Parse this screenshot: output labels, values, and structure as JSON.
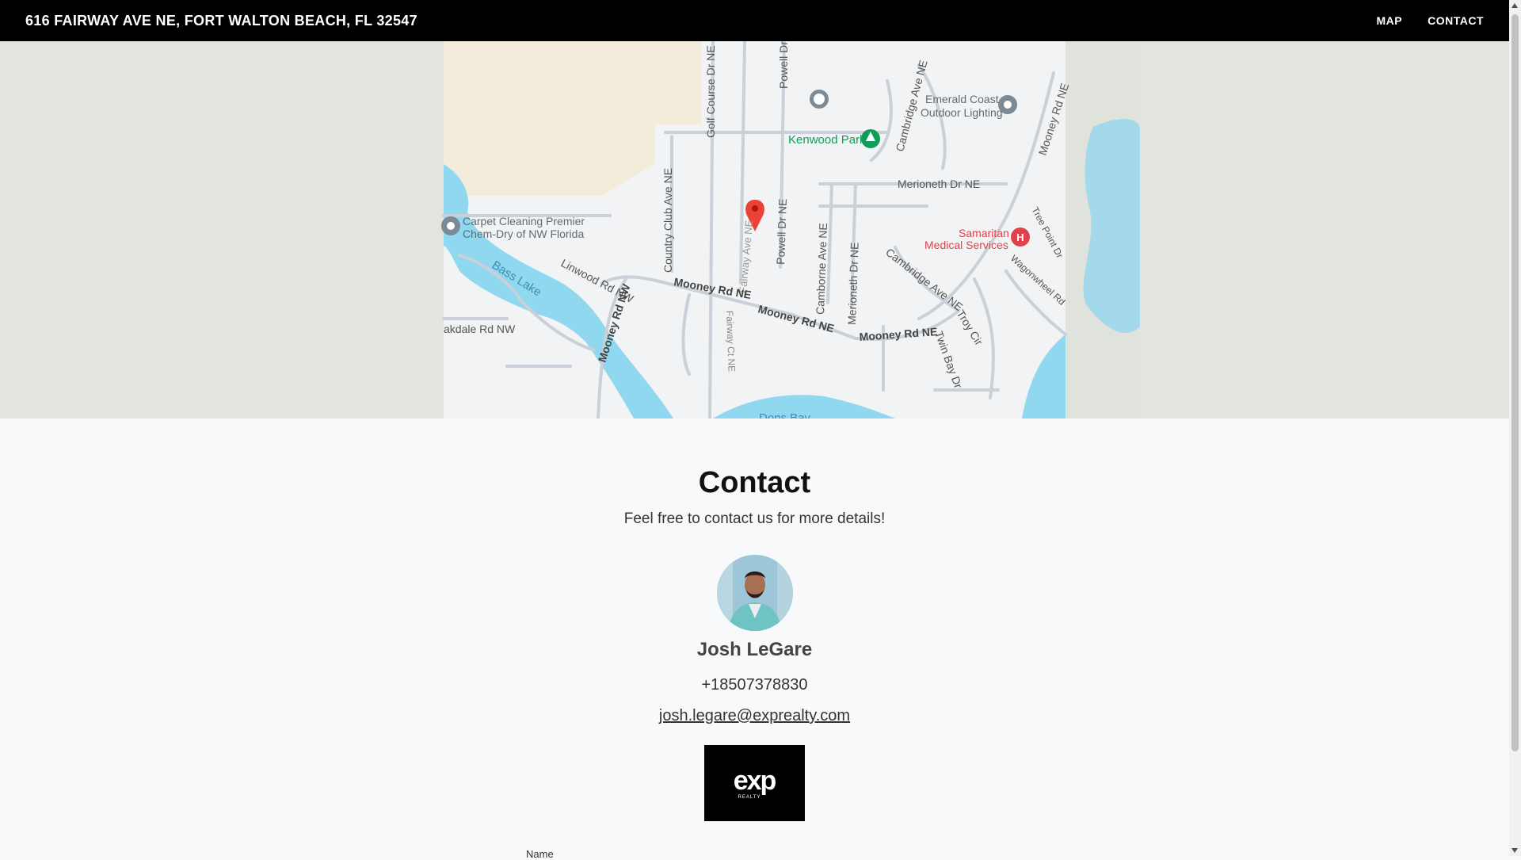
{
  "header": {
    "address": "616 FAIRWAY AVE NE, FORT WALTON BEACH, FL 32547",
    "nav": [
      {
        "label": "MAP"
      },
      {
        "label": "CONTACT"
      }
    ]
  },
  "map": {
    "labels": {
      "golf_course": "Golf Course Dr NE",
      "powell_top": "Powell Dr",
      "emerald_1": "Emerald Coast",
      "emerald_2": "Outdoor Lighting",
      "kenwood": "Kenwood Park",
      "cambridge_top": "Cambridge Ave NE",
      "mooney_right": "Mooney Rd NE",
      "merioneth_top": "Merioneth Dr NE",
      "carpet_1": "Carpet Cleaning Premier",
      "carpet_2": "Chem-Dry of NW Florida",
      "country_club": "Country Club Ave NE",
      "fairway": "Fairway Ave NE",
      "powell_mid": "Powell Dr NE",
      "camborne": "Camborne Ave NE",
      "merioneth_mid": "Merioneth Dr NE",
      "cambridge_mid": "Cambridge Ave NE",
      "tree_point": "Tree Point Dr",
      "samaritan_1": "Samaritan",
      "samaritan_2": "Medical Services",
      "wagonwheel": "Wagonwheel Rd",
      "bass_lake": "Bass Lake",
      "linwood": "Linwood Rd NW",
      "mooney_nw": "Mooney Rd NW",
      "mooney_ne1": "Mooney Rd NE",
      "mooney_ne2": "Mooney Rd NE",
      "mooney_ne3": "Mooney Rd NE",
      "troy": "Troy Cir",
      "twin_bay": "Twin Bay Dr",
      "oakdale": "akdale Rd NW",
      "fairway_ct": "Fairway Ct NE",
      "dons_bay": "Dons Bay"
    },
    "colors": {
      "land": "#f1f3f4",
      "outer": "#e5e3df",
      "water": "#8fd8ef",
      "sand": "#f3ecdb",
      "road": "#c9d0d8",
      "pin": "#ea4335",
      "park": "#0f9d58",
      "poi": "#7b8a94",
      "medical": "#e0424a"
    }
  },
  "contact": {
    "title": "Contact",
    "subtitle": "Feel free to contact us for more details!",
    "agent": {
      "name": "Josh LeGare",
      "phone": "+18507378830",
      "email": "josh.legare@exprealty.com"
    },
    "brokerage": {
      "logo_text": "exp",
      "logo_subtext": "REALTY"
    },
    "form": {
      "name_label": "Name"
    }
  }
}
